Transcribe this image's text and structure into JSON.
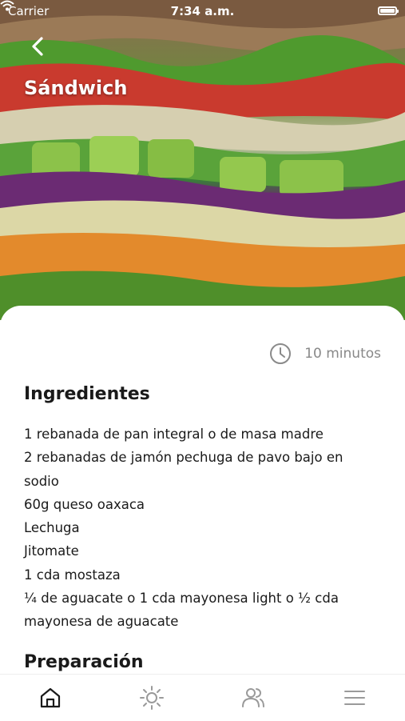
{
  "status_bar": {
    "carrier": "Carrier",
    "time": "7:34 a.m."
  },
  "header": {
    "title": "Sándwich",
    "back_icon": "chevron-left-icon"
  },
  "recipe": {
    "time_icon": "clock-icon",
    "time_label": "10 minutos",
    "ingredients_title": "Ingredientes",
    "ingredients": [
      "1 rebanada de pan integral o de masa madre",
      "2 rebanadas de jamón pechuga de pavo bajo en sodio",
      "60g queso oaxaca",
      "Lechuga",
      "Jitomate",
      "1 cda mostaza",
      "¼ de aguacate o 1 cda mayonesa light o ½ cda mayonesa de aguacate"
    ],
    "preparation_title": "Preparación"
  },
  "tab_bar": {
    "items": [
      {
        "icon": "home-icon",
        "active": true
      },
      {
        "icon": "sun-icon",
        "active": false
      },
      {
        "icon": "users-icon",
        "active": false
      },
      {
        "icon": "menu-icon",
        "active": false
      }
    ]
  },
  "colors": {
    "accent": "#1a1a1a",
    "muted": "#888888",
    "tab_inactive": "#9a9a9a"
  }
}
